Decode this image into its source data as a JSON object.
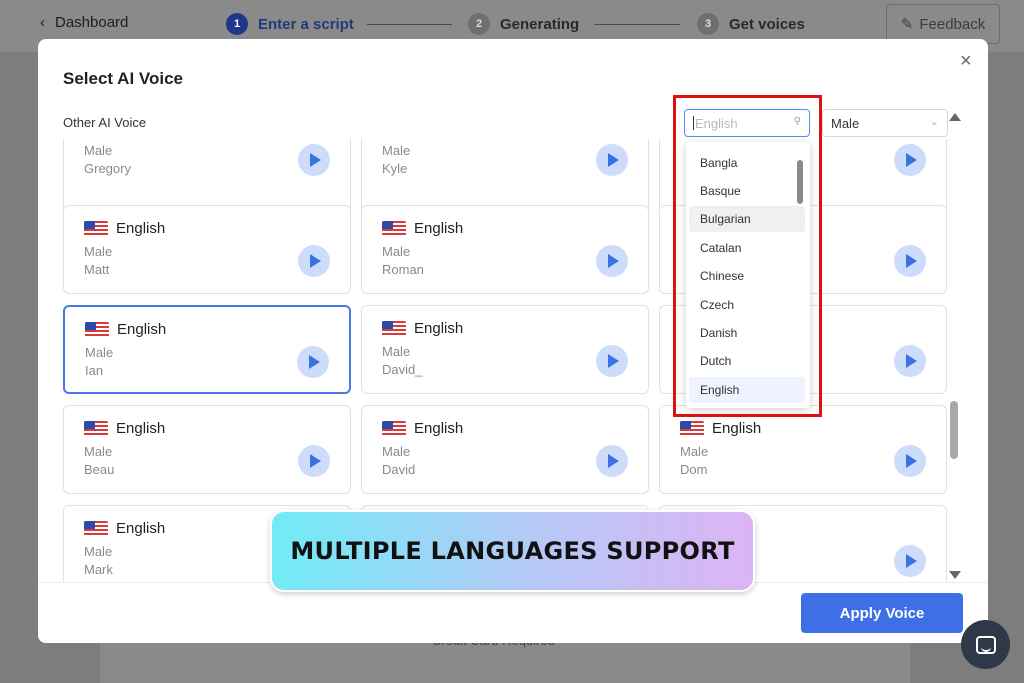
{
  "header": {
    "back_label": "Dashboard",
    "steps": [
      {
        "num": "1",
        "label": "Enter a script"
      },
      {
        "num": "2",
        "label": "Generating"
      },
      {
        "num": "3",
        "label": "Get voices"
      }
    ],
    "feedback_label": "Feedback"
  },
  "background": {
    "card_text": "Credit Card Required"
  },
  "modal": {
    "title": "Select AI Voice",
    "close": "×",
    "section_label": "Other AI Voice",
    "language_input": {
      "placeholder": "English"
    },
    "gender_select": {
      "value": "Male"
    },
    "apply_label": "Apply Voice"
  },
  "cards": [
    {
      "gender": "Male",
      "name": "Gregory"
    },
    {
      "gender": "Male",
      "name": "Kyle"
    },
    {
      "lang": "English",
      "gender": "Male",
      "name": "Matt"
    },
    {
      "lang": "English",
      "gender": "Male",
      "name": "Roman"
    },
    {
      "lang": "English",
      "gender": "Male",
      "name": "Ian"
    },
    {
      "lang": "English",
      "gender": "Male",
      "name": "David_"
    },
    {
      "lang": "English",
      "gender": "Male",
      "name": "Beau"
    },
    {
      "lang": "English",
      "gender": "Male",
      "name": "David"
    },
    {
      "lang": "English",
      "gender": "Male",
      "name": "Dom"
    },
    {
      "lang": "English",
      "gender": "Male",
      "name": "Mark"
    }
  ],
  "dropdown": {
    "items": [
      "Bangla",
      "Basque",
      "Bulgarian",
      "Catalan",
      "Chinese",
      "Czech",
      "Danish",
      "Dutch",
      "English"
    ],
    "hovered": "Bulgarian",
    "selected": "English"
  },
  "banner": {
    "text": "MULTIPLE LANGUAGES SUPPORT"
  },
  "colors": {
    "accent": "#3f6fe6",
    "highlight": "#e01010",
    "selected_border": "#4a79e6"
  }
}
